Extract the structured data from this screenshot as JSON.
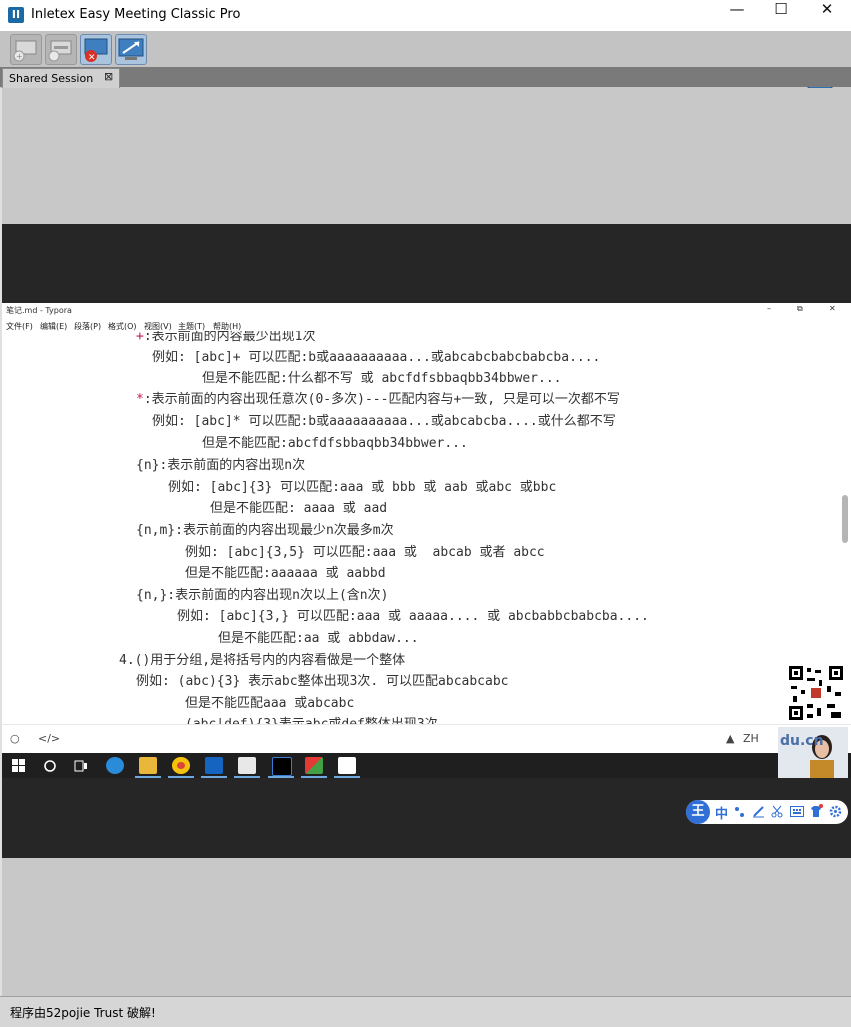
{
  "window": {
    "title": "Inletex Easy Meeting Classic Pro",
    "minimize": "—",
    "maximize": "☐",
    "close": "✕",
    "logo": "II"
  },
  "toolbar": {
    "help": "?"
  },
  "tab": {
    "label": "Shared Session",
    "close": "⊠"
  },
  "typora": {
    "title": "笔记.md - Typora",
    "controls": [
      "–",
      "⧉",
      "✕"
    ],
    "menus": [
      "文件(F)",
      "编辑(E)",
      "段落(P)",
      "格式(O)",
      "视图(V)",
      "主题(T)",
      "帮助(H)"
    ],
    "lines": [
      "+:表示前面的内容最少出现1次",
      "例如: [abc]+ 可以匹配:b或aaaaaaaaaa...或abcabcbabcbabcba....",
      "但是不能匹配:什么都不写 或 abcfdfsbbaqbb34bbwer...",
      "*:表示前面的内容出现任意次(0-多次)---匹配内容与+一致, 只是可以一次都不写",
      "例如: [abc]* 可以匹配:b或aaaaaaaaaa...或abcabcba....或什么都不写",
      "但是不能匹配:abcfdfsbbaqbb34bbwer...",
      "{n}:表示前面的内容出现n次",
      "例如: [abc]{3} 可以匹配:aaa 或 bbb 或 aab 或abc 或bbc",
      "但是不能匹配: aaaa 或 aad",
      "{n,m}:表示前面的内容出现最少n次最多m次",
      "例如: [abc]{3,5} 可以匹配:aaa 或  abcab 或者 abcc",
      "但是不能匹配:aaaaaa 或 aabbd",
      "{n,}:表示前面的内容出现n次以上(含n次)",
      "例如: [abc]{3,} 可以匹配:aaa 或 aaaaa.... 或 abcbabbcbabcba....",
      "但是不能匹配:aa 或 abbdaw...",
      "4.()用于分组,是将括号内的内容看做是一个整体",
      "例如: (abc){3} 表示abc整体出现3次. 可以匹配abcabcabc",
      "但是不能匹配aaa 或abcabc",
      "(abc|def){3}表示abc或def整体出现3次."
    ],
    "status_left_icon": "○",
    "status_code_icon": "</>",
    "status_right": "ZH",
    "status_warn": "▲"
  },
  "taskbar": {
    "icons": [
      "windows-start-icon",
      "search-icon",
      "task-view-icon",
      "edge-icon",
      "file-explorer-icon",
      "chrome-icon",
      "p-app-icon",
      "typora-icon",
      "intellij-icon",
      "app-icon",
      "photos-icon"
    ]
  },
  "webcam": {
    "watermark": "du.cn"
  },
  "ime": {
    "label": "中",
    "logo": "王"
  },
  "status_bar": {
    "text": "程序由52pojie Trust 破解!"
  }
}
